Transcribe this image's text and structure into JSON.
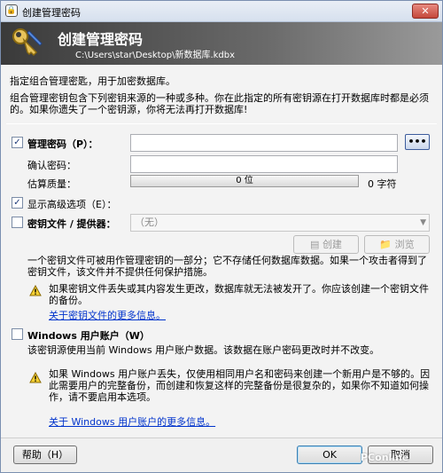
{
  "window": {
    "title": "创建管理密码"
  },
  "titlebar": {
    "close_glyph": "✕",
    "app_icon": "lock-icon"
  },
  "banner": {
    "heading": "创建管理密码",
    "path": "C:\\Users\\star\\Desktop\\新数据库.kdbx"
  },
  "intro": {
    "line1": "指定组合管理密匙，用于加密数据库。",
    "line2": "组合管理密钥包含下列密钥来源的一种或多种。你在此指定的所有密钥源在打开数据库时都是必须的。如果你遗失了一个密钥源，你将无法再打开数据库!"
  },
  "master_password": {
    "checked": true,
    "label": "管理密码（P）：",
    "confirm_label": "确认密码：",
    "quality_label": "估算质量：",
    "quality_bits": "0 位",
    "quality_fraction": 0,
    "char_count": "0 字符",
    "reveal_button": "•••"
  },
  "advanced": {
    "checked": true,
    "label": "显示高级选项（E）："
  },
  "key_file": {
    "checked": false,
    "label": "密钥文件 / 提供器：",
    "selected": "（无）",
    "create_button": "创建",
    "browse_button": "浏览",
    "description": "一个密钥文件可被用作管理密钥的一部分；它不存储任何数据库数据。如果一个攻击者得到了密钥文件，该文件并不提供任何保护措施。",
    "warning": "如果密钥文件丢失或其内容发生更改，数据库就无法被发开了。你应该创建一个密钥文件的备份。",
    "more_link": "关于密钥文件的更多信息。"
  },
  "windows_account": {
    "checked": false,
    "label": "Windows 用户账户（W）",
    "description": "该密钥源使用当前 Windows 用户账户数据。该数据在账户密码更改时并不改变。",
    "warning": "如果 Windows 用户账户丢失，仅使用相同用户名和密码来创建一个新用户是不够的。因此需要用户的完整备份，而创建和恢复这样的完整备份是很复杂的，如果你不知道如何操作，请不要启用本选项。",
    "more_link": "关于 Windows 用户账户的更多信息。"
  },
  "footer": {
    "help_button": "帮助（H）",
    "ok_button": "OK",
    "cancel_button": "取消"
  },
  "watermark": "PConline",
  "colors": {
    "link": "#0033cc",
    "banner_dark": "#3a3a3a",
    "quality_fill": "#6bd160"
  }
}
